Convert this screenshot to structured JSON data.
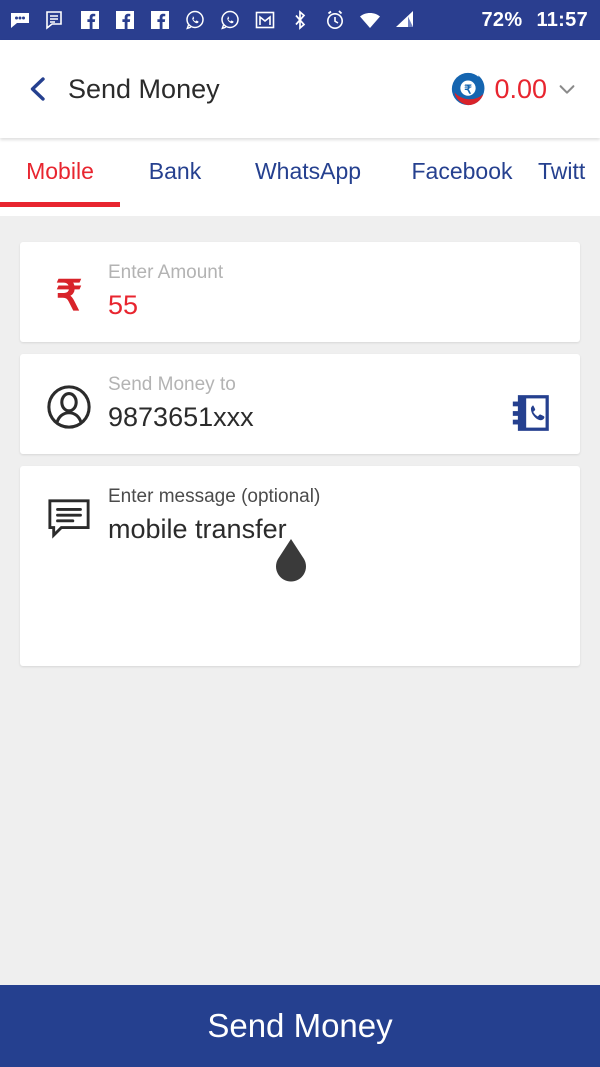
{
  "statusbar": {
    "icons": [
      "messages-icon",
      "sms-icon",
      "facebook-icon",
      "facebook-icon",
      "facebook-icon",
      "whatsapp-icon",
      "whatsapp-icon",
      "gmail-icon",
      "bluetooth-icon",
      "alarm-icon",
      "wifi-icon",
      "signal-icon"
    ],
    "battery": "72%",
    "time": "11:57",
    "background": "#2a3e8f"
  },
  "header": {
    "back_icon": "chevron-left-icon",
    "title": "Send Money",
    "wallet_icon": "wallet-rupee-logo",
    "balance": "0.00",
    "dropdown_icon": "chevron-down-icon",
    "balance_color": "#e8252f"
  },
  "tabs": {
    "active_index": 0,
    "items": [
      {
        "label": "Mobile"
      },
      {
        "label": "Bank"
      },
      {
        "label": "WhatsApp"
      },
      {
        "label": "Facebook"
      },
      {
        "label": "Twitt"
      }
    ],
    "active_color": "#e8252f",
    "inactive_color": "#25408f"
  },
  "form": {
    "amount": {
      "icon": "rupee-icon",
      "label": "Enter Amount",
      "value": "55",
      "placeholder": "Enter Amount"
    },
    "recipient": {
      "icon": "person-icon",
      "label": "Send Money to",
      "value": "9873651xxx",
      "placeholder": "Send Money to",
      "action_icon": "contacts-book-icon"
    },
    "message": {
      "icon": "message-bubble-icon",
      "label": "Enter message (optional)",
      "value": "mobile transfer",
      "placeholder": "Enter message (optional)",
      "cursor_handle_icon": "text-selection-handle-icon"
    }
  },
  "footer": {
    "send_label": "Send Money",
    "background": "#25408f"
  }
}
